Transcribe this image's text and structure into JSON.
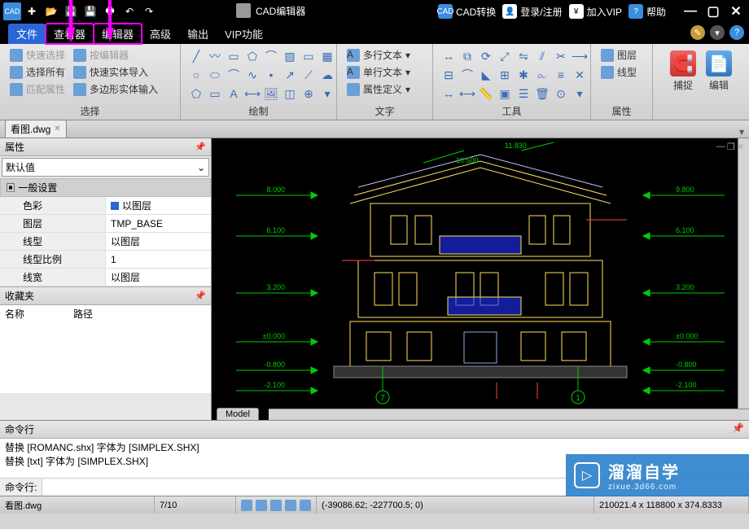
{
  "titlebar": {
    "app_title": "CAD编辑器",
    "cad_convert": "CAD转换",
    "login": "登录/注册",
    "vip": "加入VIP",
    "help": "帮助"
  },
  "menu": {
    "file": "文件",
    "viewer": "查看器",
    "editor": "编辑器",
    "advanced": "高级",
    "output": "输出",
    "vip_func": "VIP功能"
  },
  "ribbon": {
    "select_group": "选择",
    "quick_select": "快速选择",
    "by_editor": "按编辑器",
    "select_all": "选择所有",
    "solid_import": "快速实体导入",
    "match_prop": "匹配属性",
    "poly_solid": "多边形实体输入",
    "draw_group": "绘制",
    "text_group": "文字",
    "mtext": "多行文本",
    "stext": "单行文本",
    "attrdef": "属性定义",
    "tool_group": "工具",
    "prop_group": "属性",
    "layer": "图层",
    "linetype": "线型",
    "capture": "捕捉",
    "edit": "编辑"
  },
  "doc": {
    "tab": "看图.dwg"
  },
  "props": {
    "title": "属性",
    "default": "默认值",
    "section_general": "一般设置",
    "rows": [
      {
        "k": "色彩",
        "v": "以图层",
        "swatch": true
      },
      {
        "k": "图层",
        "v": "TMP_BASE"
      },
      {
        "k": "线型",
        "v": "以图层"
      },
      {
        "k": "线型比例",
        "v": "1"
      },
      {
        "k": "线宽",
        "v": "以图层"
      }
    ],
    "fav_title": "收藏夹",
    "fav_name": "名称",
    "fav_path": "路径"
  },
  "dims": {
    "d1": "8.000",
    "d2": "10.500",
    "d3": "11.830",
    "d4": "9.800",
    "d5": "6.100",
    "d6": "6.100",
    "d7": "3.200",
    "d8": "3.200",
    "d9": "±0.000",
    "d10": "±0.000",
    "d11": "-0.800",
    "d12": "-0.800",
    "d13": "-2.100",
    "d14": "-2.100",
    "m1": "7",
    "m2": "1"
  },
  "model_tab": "Model",
  "cmd": {
    "title": "命令行",
    "log1": "替换 [ROMANC.shx] 字体为 [SIMPLEX.SHX]",
    "log2": "替换 [txt] 字体为 [SIMPLEX.SHX]",
    "prompt": "命令行:"
  },
  "status": {
    "file": "看图.dwg",
    "progress": "7/10",
    "coords": "(-39086.62; -227700.5; 0)",
    "size": "210021.4 x 118800 x 374.8333"
  },
  "watermark": {
    "big": "溜溜自学",
    "small": "zixue.3d66.com"
  }
}
